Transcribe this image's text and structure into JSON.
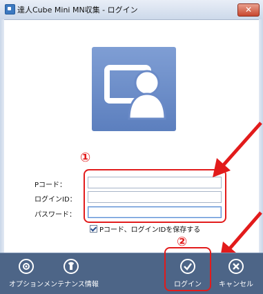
{
  "window": {
    "title": "達人Cube Mini MN収集 - ログイン",
    "close_label": "✕"
  },
  "form": {
    "pcode_label": "Pコード：",
    "login_id_label": "ログインID：",
    "password_label": "パスワード：",
    "pcode_value": "",
    "login_id_value": "",
    "password_value": "",
    "save_label": "Pコード、ログインIDを保存する",
    "save_checked": true
  },
  "annotations": {
    "marker_1": "①",
    "marker_2": "②",
    "highlight_color": "#e21b1b"
  },
  "toolbar": {
    "options_label": "オプション",
    "maintenance_label": "メンテナンス情報",
    "login_label": "ログイン",
    "cancel_label": "キャンセル"
  },
  "colors": {
    "toolbar_bg": "#4d6587",
    "logo_bg": "#6a8ac7",
    "accent_red": "#e21b1b"
  }
}
